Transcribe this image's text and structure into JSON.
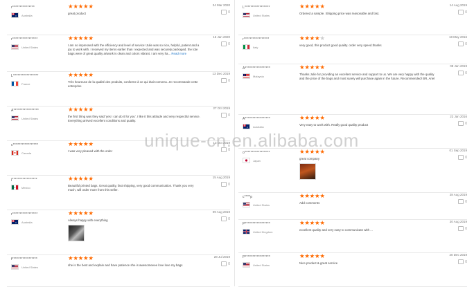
{
  "watermark": "unique-cn.en.alibaba.com",
  "colors": {
    "star": "#ff6a00",
    "link": "#1a73c6"
  },
  "reviews_left": [
    {
      "user": "r***************",
      "country": "Australia",
      "flag": "au",
      "rating": 5,
      "date": "24 Mar 2020",
      "likes": "0",
      "text": "great product",
      "readmore": ""
    },
    {
      "user": "r*****************",
      "country": "United States",
      "flag": "us",
      "rating": 5,
      "date": "16 Jan 2020",
      "likes": "0",
      "text": "I am so impressed with the efficiency and level of service! Julie was so nice, helpful, patient and a joy to work with. I received my items earlier than I expected and was securely packaged. the tote bags were of great quality artwork is clean and colors vibrant. I am very ha...",
      "readmore": "Read more"
    },
    {
      "user": "L*****************",
      "country": "France",
      "flag": "fr",
      "rating": 5,
      "date": "13 Dec 2019",
      "likes": "0",
      "text": "Très heureuse de la qualité des produits, conforme à ce qui était convenu. Je recommande cette entreprise",
      "readmore": ""
    },
    {
      "user": "A*****************",
      "country": "United States",
      "flag": "us",
      "rating": 5,
      "date": "27 Oct 2019",
      "likes": "0",
      "text": "the first thing was they said 'yes I can do it for you'. I like it this attitude and very respectful service. Everything arrived excellent conditions and quality.",
      "readmore": ""
    },
    {
      "user": "c*****************",
      "country": "Canada",
      "flag": "ca",
      "rating": 5,
      "date": "13 Oct 2019",
      "likes": "0",
      "text": "I was very pleased with the order",
      "readmore": ""
    },
    {
      "user": "j*****************",
      "country": "Mexico",
      "flag": "mx",
      "rating": 5,
      "date": "15 Aug 2019",
      "likes": "0",
      "text": "Beautiful printed bags. Great quality, fast shipping, very good communication. Thank you very much, will order more from this seller.",
      "readmore": ""
    },
    {
      "user": "r*****************",
      "country": "Australia",
      "flag": "au",
      "rating": 5,
      "date": "09 Aug 2019",
      "likes": "0",
      "text": "Always happy with everything",
      "readmore": "",
      "thumb": true
    },
    {
      "user": "f*****************",
      "country": "United States",
      "flag": "us",
      "rating": 5,
      "date": "28 Jul 2019",
      "likes": "0",
      "text": "she is the best and explain and have patience she is awesomeeee love love my bags",
      "readmore": ""
    }
  ],
  "reviews_right": [
    {
      "user": "L*****************",
      "country": "United States",
      "flag": "us",
      "rating": 5,
      "date": "14 Aug 2019",
      "likes": "0",
      "text": "Ordered a sample. Shipping price was reasonable and fast.",
      "readmore": ""
    },
    {
      "user": "r*****************",
      "country": "Italy",
      "flag": "it",
      "rating": 4,
      "date": "18 May 2016",
      "likes": "0",
      "text": "very good, this product good quality. order very speed.thanks",
      "readmore": ""
    },
    {
      "user": "A*****************",
      "country": "Malaysia",
      "flag": "my",
      "rating": 5,
      "date": "08 Jan 2019",
      "likes": "0",
      "text": "Thanks Julie for providing an excellent service and support to us. We are very happy with the quality and the price of the bags and most surely will purchase again in the future. Recommended! BR, Ariel",
      "readmore": ""
    },
    {
      "user": "A*****************",
      "country": "Australia",
      "flag": "au",
      "rating": 5,
      "date": "22 Jan 2016",
      "likes": "0",
      "text": "Very easy to work with. Really good quality product",
      "readmore": ""
    },
    {
      "user": "o*****************",
      "country": "Japan",
      "flag": "jp",
      "rating": 5,
      "date": "01 Sep 2019",
      "likes": "0",
      "text": "great company",
      "readmore": "",
      "thumb": true
    },
    {
      "user": "c****p",
      "country": "United States",
      "flag": "us",
      "rating": 5,
      "date": "28 Aug 2019",
      "likes": "0",
      "text": "Add comments",
      "readmore": ""
    },
    {
      "user": "P*****************",
      "country": "United Kingdom",
      "flag": "gb",
      "rating": 5,
      "date": "20 Aug 2019",
      "likes": "0",
      "text": "excellent quality and very easy to communicate with ...",
      "readmore": ""
    },
    {
      "user": "P*****************",
      "country": "United States",
      "flag": "us",
      "rating": 5,
      "date": "20 Dec 2019",
      "likes": "0",
      "text": "Nice product & great service",
      "readmore": ""
    }
  ]
}
